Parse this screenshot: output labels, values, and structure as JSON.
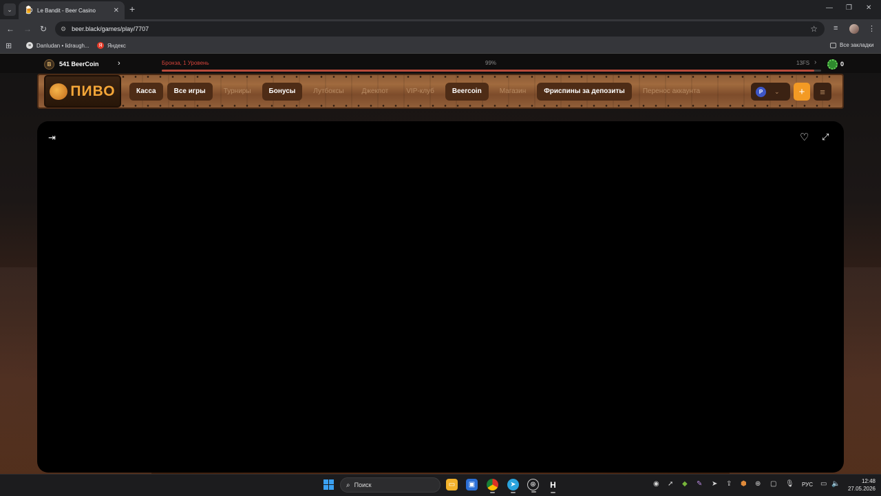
{
  "browser": {
    "tab_title": "Le Bandit - Beer Casino",
    "tab_favicon": "beer-icon",
    "url": "beer.black/games/play/7707",
    "bookmarks": [
      {
        "label": "Danludan • lidraugh..."
      },
      {
        "label": "Яндекс"
      }
    ],
    "all_bookmarks_label": "Все закладки"
  },
  "site": {
    "beercoin": "541 BeerCoin",
    "coin_letter": "B",
    "level": "Бронза, 1 Уровень",
    "progress_text": "99%",
    "progress_value": 0.99,
    "freespins": "13FS",
    "gear_count": "0",
    "logo_text": "ПИВО",
    "currency_letter": "P",
    "plus_label": "+",
    "nav": [
      {
        "label": "Касса",
        "active": true
      },
      {
        "label": "Все игры",
        "active": true
      },
      {
        "label": "Турниры",
        "active": false
      },
      {
        "label": "Бонусы",
        "active": true
      },
      {
        "label": "Лутбоксы",
        "active": false
      },
      {
        "label": "Джекпот",
        "active": false
      },
      {
        "label": "VIP-клуб",
        "active": false
      },
      {
        "label": "Beercoin",
        "active": true
      },
      {
        "label": "Магазин",
        "active": false
      },
      {
        "label": "Фриспины за депозиты",
        "active": true
      },
      {
        "label": "Перенос аккаунта",
        "active": false
      }
    ],
    "colors": {
      "accent": "#f39a24",
      "level_red": "#d3433a",
      "wood": "#8a5a36",
      "currency_blue": "#3d56c6"
    }
  },
  "taskbar": {
    "search_placeholder": "Поиск",
    "lang": "РУС",
    "time": "12:48",
    "date": "27.05.2026"
  }
}
